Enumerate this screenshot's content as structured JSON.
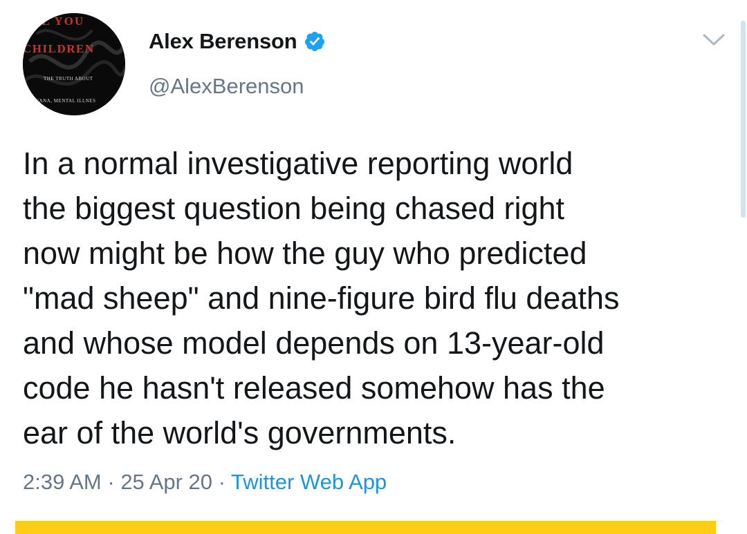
{
  "author": {
    "display_name": "Alex Berenson",
    "handle": "@AlexBerenson",
    "verified": true,
    "avatar": {
      "line1": "LL YOU",
      "line2": "CHILDREN",
      "line3": "THE TRUTH ABOUT",
      "line4": "IJUANA, MENTAL ILLNES"
    }
  },
  "tweet": {
    "text": "In a normal investigative reporting world\nthe biggest question being chased right\nnow might be how the guy who predicted\n\"mad sheep\" and nine-figure bird flu deaths\nand whose model depends on 13-year-old\ncode he hasn't released somehow has the\near of the world's governments.",
    "time": "2:39 AM",
    "separator": " · ",
    "date": "25 Apr 20",
    "source": "Twitter Web App"
  },
  "colors": {
    "verified_blue": "#1da1f2",
    "link_blue": "#1b95e0",
    "muted_gray": "#657786",
    "avatar_red": "#c8342c",
    "banner_yellow": "#ffcd16"
  },
  "icons": {
    "verified": "verified-badge-icon",
    "menu": "chevron-down-icon"
  }
}
